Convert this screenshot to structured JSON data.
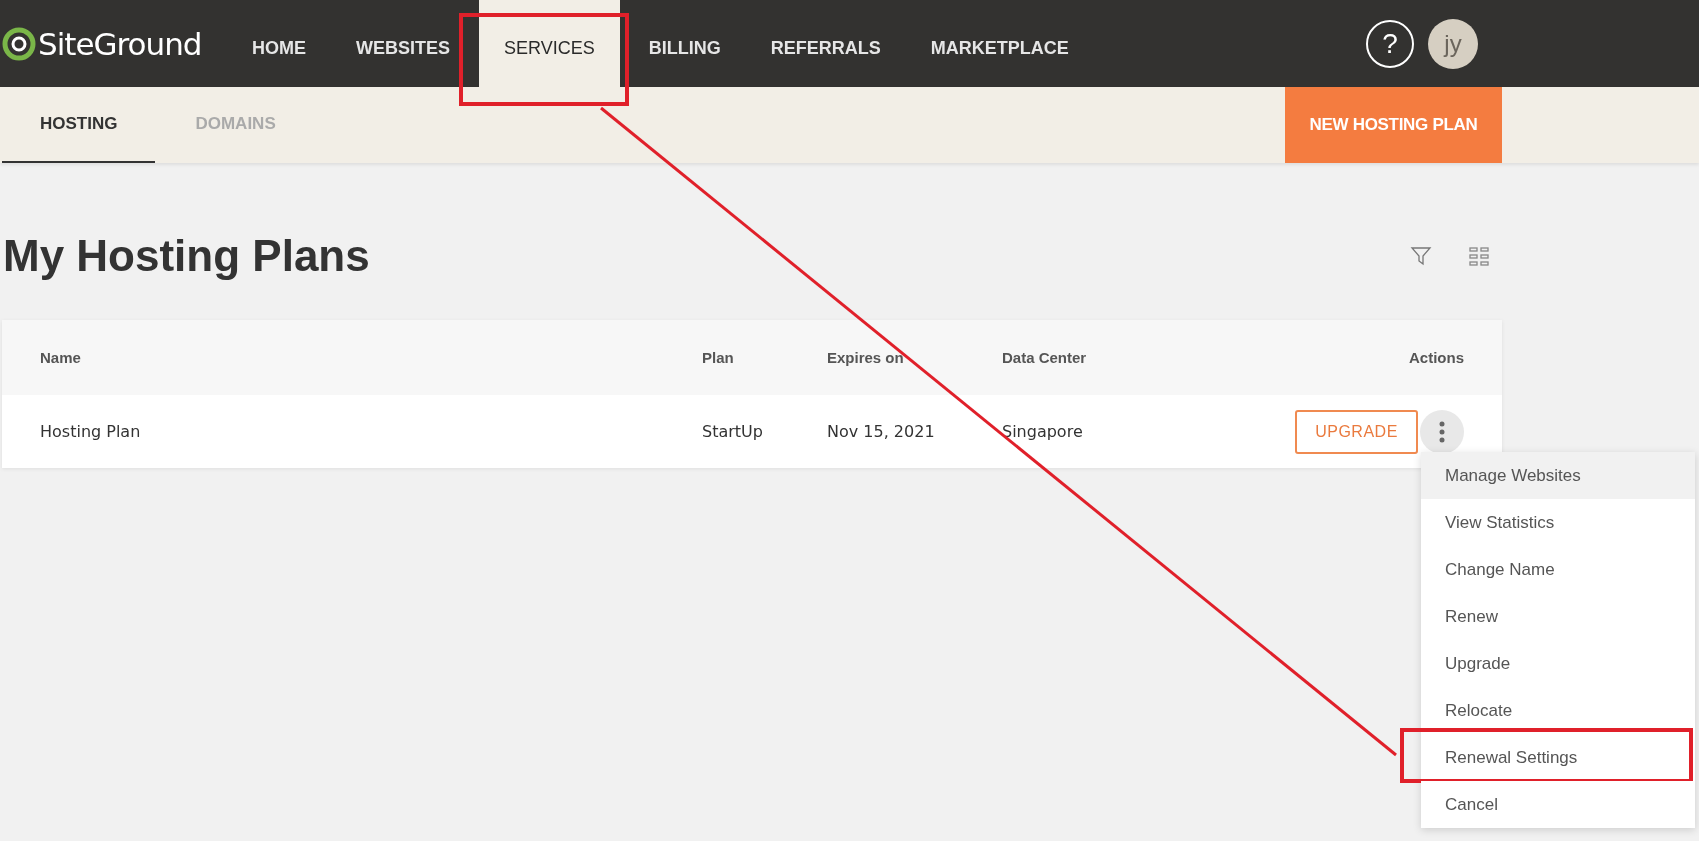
{
  "logo": {
    "text": "SiteGround"
  },
  "nav": [
    {
      "label": "HOME",
      "selected": false,
      "highlighted": false
    },
    {
      "label": "WEBSITES",
      "selected": false,
      "highlighted": false
    },
    {
      "label": "SERVICES",
      "selected": true,
      "highlighted": true
    },
    {
      "label": "BILLING",
      "selected": false,
      "highlighted": false
    },
    {
      "label": "REFERRALS",
      "selected": false,
      "highlighted": false
    },
    {
      "label": "MARKETPLACE",
      "selected": false,
      "highlighted": false
    }
  ],
  "help": "?",
  "avatar": "jy",
  "subtabs": [
    {
      "label": "HOSTING",
      "selected": true
    },
    {
      "label": "DOMAINS",
      "selected": false
    }
  ],
  "new_plan_button": "NEW HOSTING PLAN",
  "page_title": "My Hosting Plans",
  "table": {
    "columns": [
      "Name",
      "Plan",
      "Expires on",
      "Data Center",
      "Actions"
    ],
    "rows": [
      {
        "cells": [
          "Hosting Plan",
          "StartUp",
          "Nov 15, 2021",
          "Singapore"
        ],
        "action": "UPGRADE"
      }
    ]
  },
  "menu": {
    "items": [
      {
        "label": "Manage Websites",
        "selected": true,
        "highlighted": false
      },
      {
        "label": "View Statistics",
        "selected": false,
        "highlighted": false
      },
      {
        "label": "Change Name",
        "selected": false,
        "highlighted": false
      },
      {
        "label": "Renew",
        "selected": false,
        "highlighted": false
      },
      {
        "label": "Upgrade",
        "selected": false,
        "highlighted": false
      },
      {
        "label": "Relocate",
        "selected": false,
        "highlighted": false
      },
      {
        "label": "Renewal Settings",
        "selected": false,
        "highlighted": true
      },
      {
        "label": "Cancel",
        "selected": false,
        "highlighted": false
      }
    ]
  }
}
